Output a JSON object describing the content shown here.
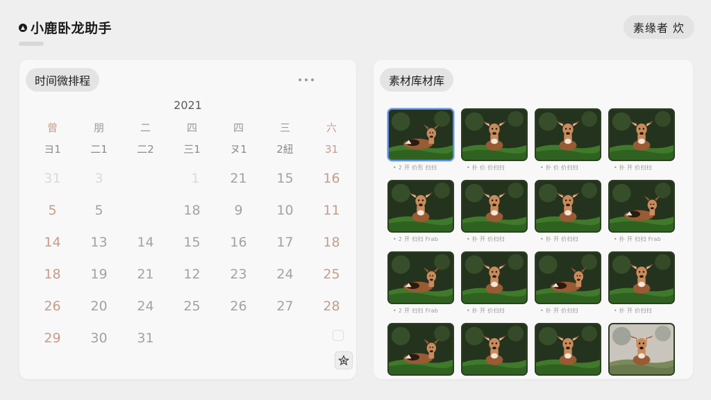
{
  "header": {
    "app_title": "小鹿卧龙助手",
    "user_label": "素缘者 炊"
  },
  "colors": {
    "accent_selected": "#5c8ee0",
    "weekend": "#c49d8a",
    "muted_day": "#a2a2a2"
  },
  "calendar": {
    "panel_title": "时间微排程",
    "more_icon": "more-horizontal-icon",
    "year": "2021",
    "weekday_headers": [
      "曾",
      "朋",
      "二",
      "四",
      "四",
      "三",
      "六"
    ],
    "sub_row": [
      "ヨ1",
      "二1",
      "二2",
      "三1",
      "ヌ1",
      "2紐",
      "31"
    ],
    "days": [
      [
        "31",
        "3",
        "",
        " 1",
        "21",
        "15",
        "16"
      ],
      [
        "5",
        "5",
        "",
        "18",
        "9",
        "10",
        "11"
      ],
      [
        "14",
        "13",
        "14",
        "15",
        "16",
        "17",
        "18"
      ],
      [
        "18",
        "19",
        "21",
        "12",
        "23",
        "24",
        "25"
      ],
      [
        "26",
        "20",
        "24",
        "25",
        "26",
        "27",
        "28"
      ],
      [
        "29",
        "30",
        "31",
        "",
        "",
        "",
        ""
      ]
    ],
    "corner_icon": "star-badge-icon"
  },
  "assets": {
    "panel_title": "素材库材库",
    "items": [
      {
        "caption": "• 2 开 价形 扫扫",
        "pose": "lying",
        "selected": true
      },
      {
        "caption": "• 扑 价 价扫扫",
        "pose": "sitting"
      },
      {
        "caption": "• 扑 价 价扫扫",
        "pose": "sitting"
      },
      {
        "caption": "• 扑 开 价扫扫",
        "pose": "sitting"
      },
      {
        "caption": "• 2 开 扫扫 Frab",
        "pose": "sitting"
      },
      {
        "caption": "• 扑 开 价扫扫",
        "pose": "sitting"
      },
      {
        "caption": "• 扑 开 价扫扫",
        "pose": "sitting"
      },
      {
        "caption": "• 扑 开 扫扫 Frab",
        "pose": "lying"
      },
      {
        "caption": "• 2 开 扫扫 Frab",
        "pose": "lying"
      },
      {
        "caption": "• 扑 开 价扫扫",
        "pose": "sitting"
      },
      {
        "caption": "• 扑 开 价扫扫",
        "pose": "lying"
      },
      {
        "caption": "• 扑 开 价扫扫",
        "pose": "sitting"
      },
      {
        "caption": "",
        "pose": "lying"
      },
      {
        "caption": "",
        "pose": "sitting"
      },
      {
        "caption": "",
        "pose": "sitting"
      },
      {
        "caption": "",
        "pose": "sitting-light"
      }
    ]
  }
}
